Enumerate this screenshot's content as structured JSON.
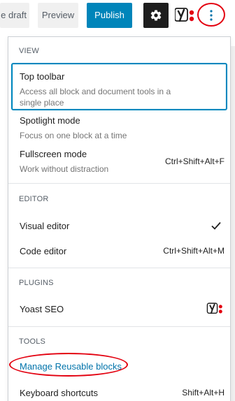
{
  "toolbar": {
    "save_draft_label": "e draft",
    "preview_label": "Preview",
    "publish_label": "Publish",
    "settings_icon": "gear-icon",
    "yoast_icon": "yoast-logo-icon",
    "more_icon": "more-vertical-icon"
  },
  "menu": {
    "view": {
      "label": "VIEW",
      "top_toolbar": {
        "label": "Top toolbar",
        "description": "Access all block and document tools in a single place"
      },
      "spotlight": {
        "label": "Spotlight mode",
        "description": "Focus on one block at a time"
      },
      "fullscreen": {
        "label": "Fullscreen mode",
        "description": "Work without distraction",
        "shortcut": "Ctrl+Shift+Alt+F"
      }
    },
    "editor": {
      "label": "EDITOR",
      "visual": {
        "label": "Visual editor",
        "checked": true
      },
      "code": {
        "label": "Code editor",
        "shortcut": "Ctrl+Shift+Alt+M"
      }
    },
    "plugins": {
      "label": "PLUGINS",
      "yoast": {
        "label": "Yoast SEO"
      }
    },
    "tools": {
      "label": "TOOLS",
      "reusable": {
        "label": "Manage Reusable blocks"
      },
      "keyboard": {
        "label": "Keyboard shortcuts",
        "shortcut": "Shift+Alt+H"
      }
    }
  },
  "colors": {
    "publish": "#0085ba",
    "focus_border": "#0087be",
    "link": "#0073aa",
    "annotation_red": "#e3000f",
    "yoast_purple": "#a4286a"
  }
}
